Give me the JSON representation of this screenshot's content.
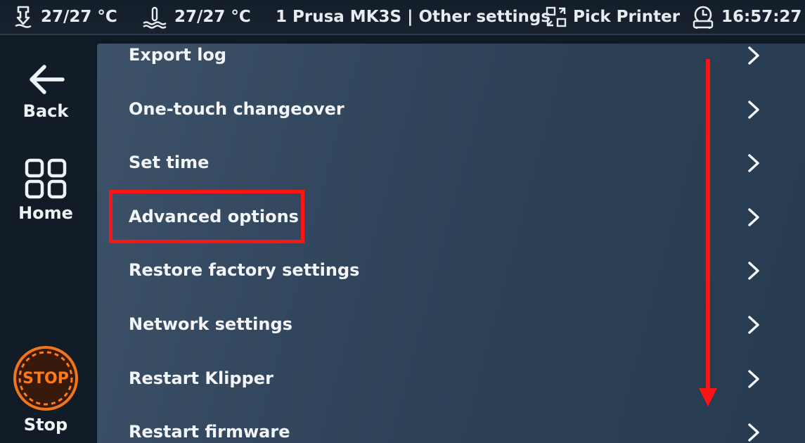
{
  "status_bar": {
    "nozzle_temp": "27/27 °C",
    "bed_temp": "27/27 °C",
    "printer_title": "1 Prusa MK3S | Other settings",
    "pick_printer": "Pick Printer",
    "time": "16:57:27"
  },
  "nav": {
    "back": "Back",
    "home": "Home",
    "stop_badge": "STOP",
    "stop": "Stop"
  },
  "menu": {
    "items": [
      {
        "label": "Export log"
      },
      {
        "label": "One-touch changeover"
      },
      {
        "label": "Set time"
      },
      {
        "label": "Advanced options"
      },
      {
        "label": "Restore factory settings"
      },
      {
        "label": "Network settings"
      },
      {
        "label": "Restart Klipper"
      },
      {
        "label": "Restart firmware"
      }
    ]
  },
  "colors": {
    "highlight": "#ff1414",
    "stop_orange": "#ff7a1a"
  },
  "icons": {
    "nozzle": "nozzle-temp-icon",
    "bed": "bed-temp-icon",
    "pick": "pick-printer-icon",
    "clock": "printer-clock-icon",
    "back": "arrow-left-icon",
    "home": "grid-home-icon",
    "stop": "stop-icon",
    "chevron": "chevron-right-icon"
  }
}
